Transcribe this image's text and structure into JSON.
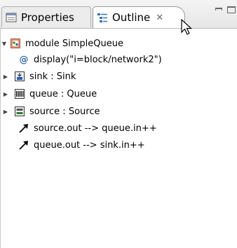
{
  "tabs": {
    "properties_label": "Properties",
    "outline_label": "Outline",
    "close_glyph": "✕"
  },
  "tree": {
    "root": {
      "label": "module SimpleQueue",
      "expanded": true,
      "icon": "module-icon"
    },
    "children": [
      {
        "label": "display(\"i=block/network2\")",
        "icon": "at-icon",
        "expandable": false
      },
      {
        "label": "sink : Sink",
        "icon": "sink-submodule-icon",
        "expandable": true
      },
      {
        "label": "queue : Queue",
        "icon": "queue-submodule-icon",
        "expandable": true
      },
      {
        "label": "source : Source",
        "icon": "source-submodule-icon",
        "expandable": true
      },
      {
        "label": "source.out --> queue.in++",
        "icon": "connection-icon",
        "expandable": false
      },
      {
        "label": "queue.out --> sink.in++",
        "icon": "connection-icon",
        "expandable": false
      }
    ]
  },
  "colors": {
    "at_sign": "#3a6ea5",
    "connection_arrow": "#000000",
    "tab_outline_icon": "#3b6fb6"
  }
}
